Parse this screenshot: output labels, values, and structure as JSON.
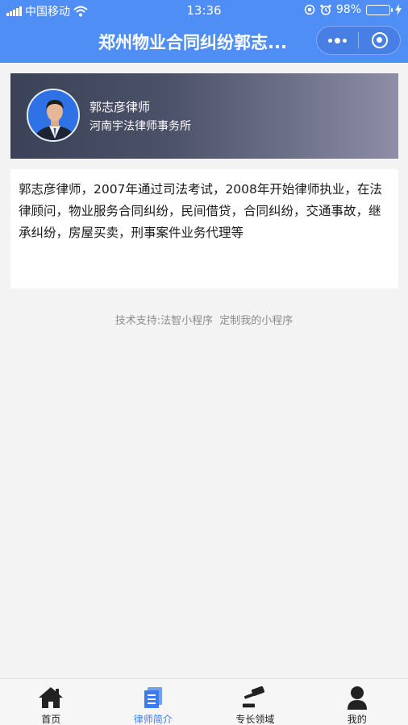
{
  "status_bar": {
    "carrier": "中国移动",
    "time": "13:36",
    "battery_percent": "98%",
    "battery_level": 0.98
  },
  "nav": {
    "title": "郑州物业合同纠纷郭志..."
  },
  "profile": {
    "name": "郭志彦律师",
    "firm": "河南宇法律师事务所"
  },
  "intro": {
    "text": "郭志彦律师，2007年通过司法考试，2008年开始律师执业，在法律顾问，物业服务合同纠纷，民间借贷，合同纠纷，交通事故，继承纠纷，房屋买卖，刑事案件业务代理等"
  },
  "support": {
    "prefix": "技术支持:法智小程序",
    "link": "定制我的小程序"
  },
  "tabbar": {
    "items": [
      {
        "label": "首页",
        "icon": "home-icon",
        "active": false
      },
      {
        "label": "律师简介",
        "icon": "profile-doc-icon",
        "active": true
      },
      {
        "label": "专长领域",
        "icon": "gavel-icon",
        "active": false
      },
      {
        "label": "我的",
        "icon": "user-icon",
        "active": false
      }
    ],
    "active_color": "#3d7cf0",
    "inactive_color": "#222222"
  },
  "colors": {
    "header": "#4f8ef5",
    "background": "#f3f3f3"
  }
}
